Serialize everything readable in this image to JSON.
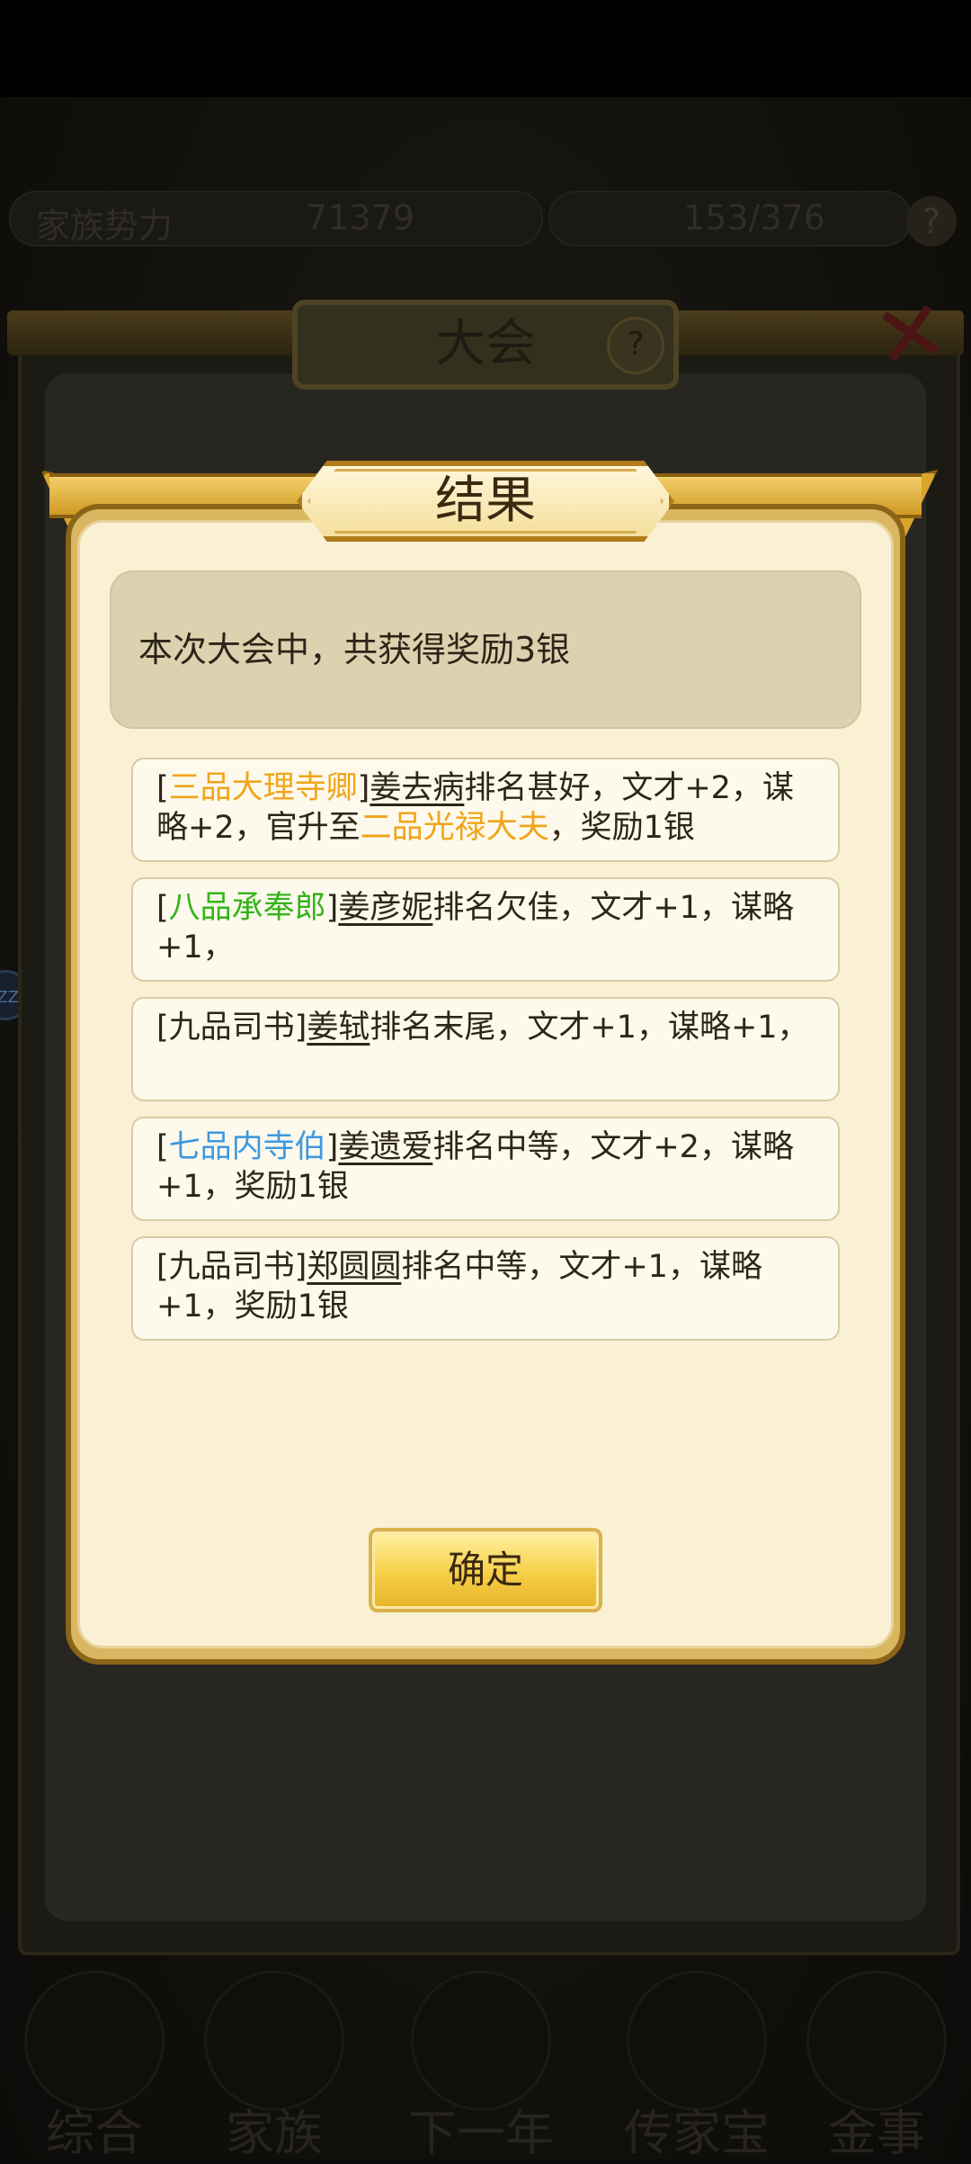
{
  "background": {
    "topbar": {
      "left_label": "家族势力",
      "left_value": "71379",
      "right_value": "153/376"
    },
    "side_button_label": "ZZ",
    "bottom_nav": [
      {
        "label": "综合",
        "icon": "overview-icon"
      },
      {
        "label": "家族",
        "icon": "family-icon"
      },
      {
        "label": "下一年",
        "icon": "next-year-icon"
      },
      {
        "label": "传家宝",
        "icon": "heirloom-icon"
      },
      {
        "label": "金事",
        "icon": "gold-icon"
      }
    ]
  },
  "outer_panel": {
    "title": "大会",
    "help_icon": "question-icon",
    "close_icon": "close-icon"
  },
  "result_dialog": {
    "title": "结果",
    "summary": "本次大会中，共获得奖励3银",
    "entries": [
      {
        "rank": "三品大理寺卿",
        "rank_color": "#f0a51a",
        "name": "姜去病",
        "text": "排名甚好，文才+2，谋略+2，官升至",
        "promotion": "二品光禄大夫",
        "promotion_color": "#f0a51a",
        "tail": "，奖励1银"
      },
      {
        "rank": "八品承奉郎",
        "rank_color": "#33b319",
        "name": "姜彦妮",
        "text": "排名欠佳，文才+1，谋略+1，"
      },
      {
        "rank": "九品司书",
        "rank_color": "#2d2618",
        "name": "姜轼",
        "text": "排名末尾，文才+1，谋略+1，"
      },
      {
        "rank": "七品内寺伯",
        "rank_color": "#3d99e0",
        "name": "姜遗爱",
        "text": "排名中等，文才+2，谋略+1，奖励1银"
      },
      {
        "rank": "九品司书",
        "rank_color": "#2d2618",
        "name": "郑圆圆",
        "text": "排名中等，文才+1，谋略+1，奖励1银"
      }
    ],
    "confirm_label": "确定"
  }
}
